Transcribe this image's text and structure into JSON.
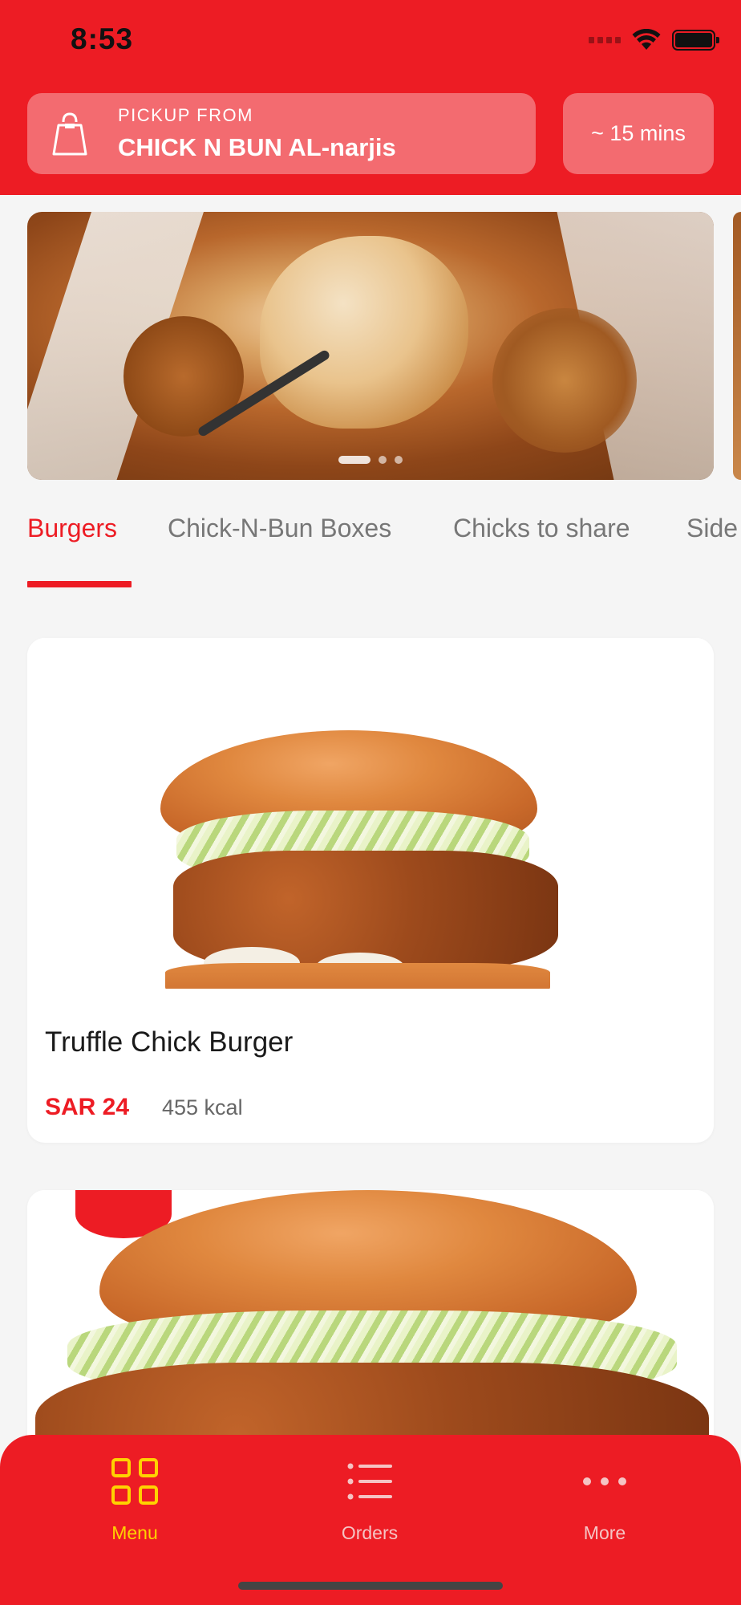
{
  "status_bar": {
    "time": "8:53"
  },
  "pickup": {
    "label": "PICKUP FROM",
    "store": "CHICK N BUN AL-narjis"
  },
  "eta": {
    "text": "~ 15 mins"
  },
  "banner": {
    "slide_count": 3,
    "active_slide": 1
  },
  "tabs": [
    {
      "label": "Burgers",
      "active": true
    },
    {
      "label": "Chick-N-Bun Boxes",
      "active": false
    },
    {
      "label": "Chicks to share",
      "active": false
    },
    {
      "label": "Side",
      "active": false
    }
  ],
  "menu_items": [
    {
      "name": "Truffle Chick Burger",
      "price": "SAR 24",
      "kcal": "455 kcal"
    }
  ],
  "bottom_nav": [
    {
      "label": "Menu",
      "icon": "grid-icon",
      "active": true
    },
    {
      "label": "Orders",
      "icon": "list-icon",
      "active": false
    },
    {
      "label": "More",
      "icon": "more-dots-icon",
      "active": false
    }
  ],
  "colors": {
    "brand_red": "#ed1c24",
    "active_nav": "#ffd200"
  }
}
